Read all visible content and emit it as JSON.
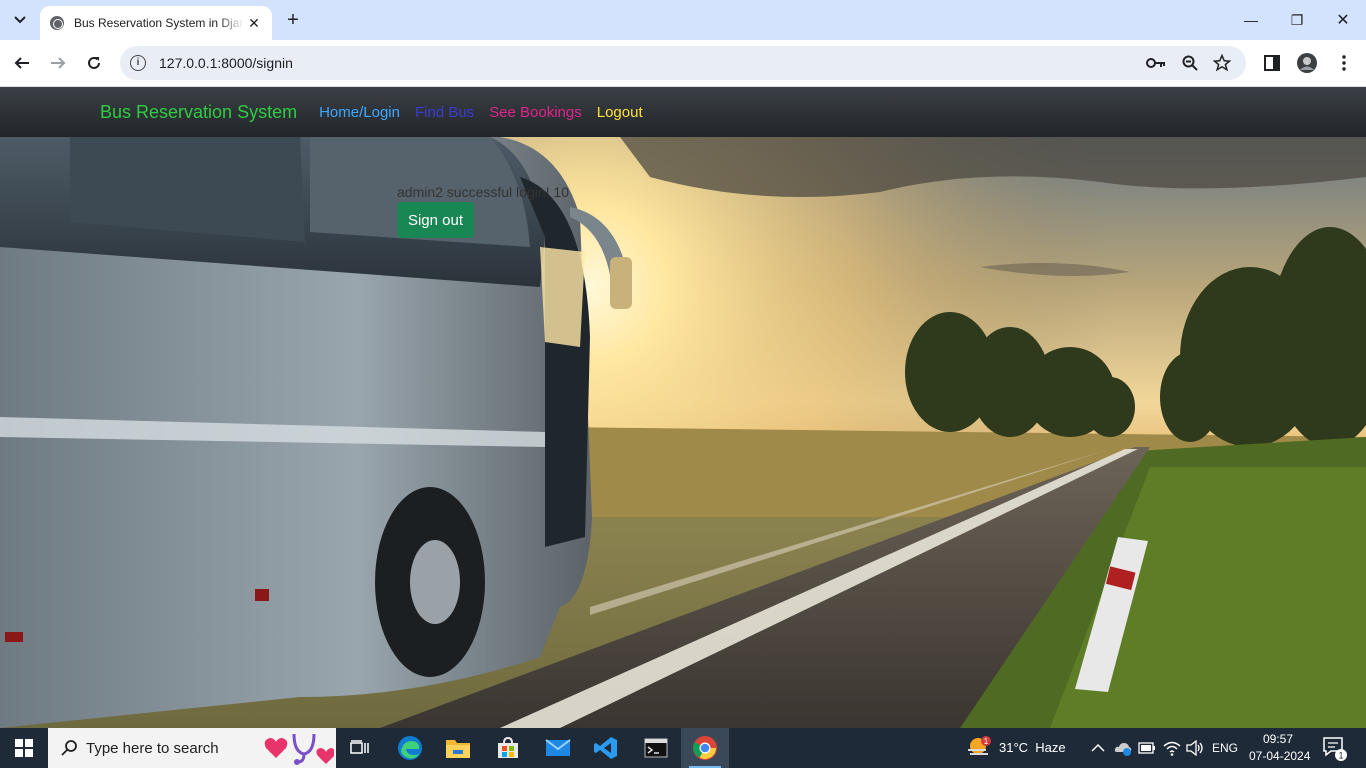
{
  "browser": {
    "tab_title": "Bus Reservation System in Django",
    "tab_close": "✕",
    "new_tab": "+",
    "url": "127.0.0.1:8000/signin",
    "window_controls": {
      "minimize": "—",
      "restore": "❐",
      "close": "✕"
    }
  },
  "site": {
    "brand": "Bus Reservation System",
    "brand_color": "#2ecc40",
    "nav": [
      {
        "label": "Home/Login",
        "color": "#3ea8ff"
      },
      {
        "label": "Find Bus",
        "color": "#3b3bd4"
      },
      {
        "label": "See Bookings",
        "color": "#e0248c"
      },
      {
        "label": "Logout",
        "color": "#ffe234"
      }
    ],
    "message": "admin2 successful login! 10",
    "signout_label": "Sign out",
    "signout_color": "#198754"
  },
  "taskbar": {
    "search_placeholder": "Type here to search",
    "weather": "31°C  Haze",
    "weather_badge": "1",
    "language": "ENG",
    "time": "09:57",
    "date": "07-04-2024",
    "notification_count": "1",
    "apps": [
      "windows-start",
      "task-view",
      "edge",
      "file-explorer",
      "microsoft-store",
      "mail",
      "vscode",
      "terminal",
      "chrome"
    ]
  }
}
